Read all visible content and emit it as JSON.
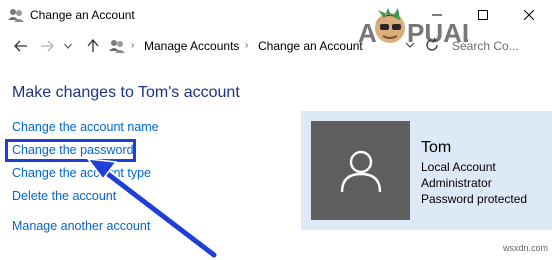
{
  "window": {
    "title": "Change an Account"
  },
  "address_bar": {
    "crumbs": [
      "Manage Accounts",
      "Change an Account"
    ],
    "search_placeholder": "Search Co..."
  },
  "main": {
    "heading": "Make changes to Tom's account",
    "links": {
      "rename": "Change the account name",
      "password": "Change the password",
      "type": "Change the account type",
      "delete": "Delete the account",
      "manage": "Manage another account"
    }
  },
  "account": {
    "name": "Tom",
    "details": [
      "Local Account",
      "Administrator",
      "Password protected"
    ]
  },
  "watermark": {
    "brand": "APPUALS",
    "site": "wsxdn.com"
  },
  "colors": {
    "link": "#0066cc",
    "heading": "#1e3287",
    "highlight": "#1f3fd6",
    "account_panel": "#dde9f6",
    "avatar_bg": "#5e5e5e"
  }
}
